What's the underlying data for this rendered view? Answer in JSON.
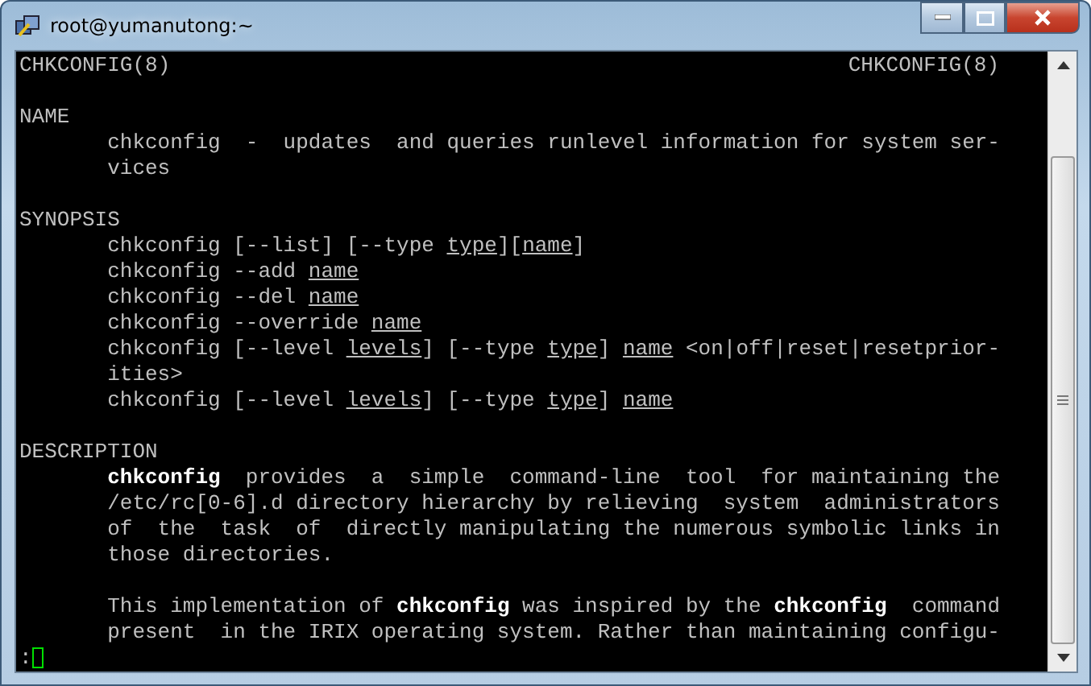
{
  "window": {
    "title": "root@yumanutong:~"
  },
  "terminal": {
    "header": {
      "left": "CHKCONFIG(8)",
      "right": "CHKCONFIG(8)"
    },
    "sections": [
      {
        "heading": "NAME",
        "paragraphs": [
          [
            [
              {
                "text": "chkconfig  -  updates  and queries runlevel information for system ser-",
                "kind": "plain"
              }
            ],
            [
              {
                "text": "vices",
                "kind": "plain"
              }
            ]
          ]
        ]
      },
      {
        "heading": "SYNOPSIS",
        "paragraphs": [
          [
            [
              {
                "text": "chkconfig [--list] [--type ",
                "kind": "plain"
              },
              {
                "text": "type",
                "kind": "underline"
              },
              {
                "text": "][",
                "kind": "plain"
              },
              {
                "text": "name",
                "kind": "underline"
              },
              {
                "text": "]",
                "kind": "plain"
              }
            ],
            [
              {
                "text": "chkconfig --add ",
                "kind": "plain"
              },
              {
                "text": "name",
                "kind": "underline"
              }
            ],
            [
              {
                "text": "chkconfig --del ",
                "kind": "plain"
              },
              {
                "text": "name",
                "kind": "underline"
              }
            ],
            [
              {
                "text": "chkconfig --override ",
                "kind": "plain"
              },
              {
                "text": "name",
                "kind": "underline"
              }
            ],
            [
              {
                "text": "chkconfig [--level ",
                "kind": "plain"
              },
              {
                "text": "levels",
                "kind": "underline"
              },
              {
                "text": "] [--type ",
                "kind": "plain"
              },
              {
                "text": "type",
                "kind": "underline"
              },
              {
                "text": "] ",
                "kind": "plain"
              },
              {
                "text": "name",
                "kind": "underline"
              },
              {
                "text": " <on|off|reset|resetprior-",
                "kind": "plain"
              }
            ],
            [
              {
                "text": "ities>",
                "kind": "plain"
              }
            ],
            [
              {
                "text": "chkconfig [--level ",
                "kind": "plain"
              },
              {
                "text": "levels",
                "kind": "underline"
              },
              {
                "text": "] [--type ",
                "kind": "plain"
              },
              {
                "text": "type",
                "kind": "underline"
              },
              {
                "text": "] ",
                "kind": "plain"
              },
              {
                "text": "name",
                "kind": "underline"
              }
            ]
          ]
        ]
      },
      {
        "heading": "DESCRIPTION",
        "paragraphs": [
          [
            [
              {
                "text": "chkconfig",
                "kind": "bold"
              },
              {
                "text": "  provides  a  simple  command-line  tool  for maintaining the",
                "kind": "plain"
              }
            ],
            [
              {
                "text": "/etc/rc[0-6].d directory hierarchy by relieving  system  administrators",
                "kind": "plain"
              }
            ],
            [
              {
                "text": "of  the  task  of  directly manipulating the numerous symbolic links in",
                "kind": "plain"
              }
            ],
            [
              {
                "text": "those directories.",
                "kind": "plain"
              }
            ]
          ],
          [
            [
              {
                "text": "This implementation of ",
                "kind": "plain"
              },
              {
                "text": "chkconfig",
                "kind": "bold"
              },
              {
                "text": " was inspired by the ",
                "kind": "plain"
              },
              {
                "text": "chkconfig",
                "kind": "bold"
              },
              {
                "text": "  command",
                "kind": "plain"
              }
            ],
            [
              {
                "text": "present  in the IRIX operating system. Rather than maintaining configu-",
                "kind": "plain"
              }
            ]
          ]
        ]
      }
    ],
    "prompt": ":"
  }
}
